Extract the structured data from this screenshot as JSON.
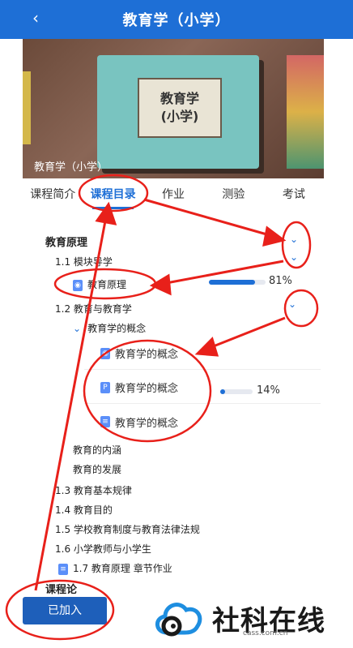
{
  "header": {
    "back_glyph": "‹",
    "title": "教育学（小学）"
  },
  "banner": {
    "book_line1": "教育学",
    "book_line2": "(小学)",
    "caption": "教育学（小学）"
  },
  "tabs": [
    {
      "label": "课程简介"
    },
    {
      "label": "课程目录"
    },
    {
      "label": "作业"
    },
    {
      "label": "测验"
    },
    {
      "label": "考试"
    }
  ],
  "catalog": {
    "section_title": "教育原理",
    "items": [
      {
        "label": "1.1 模块导学"
      },
      {
        "label": "教育原理",
        "progress": 0.81,
        "pct": "81%"
      },
      {
        "label": "1.2 教育与教育学"
      },
      {
        "label": "教育学的概念"
      },
      {
        "label": "教育学的概念"
      },
      {
        "label": "教育学的概念",
        "progress": 0.14,
        "pct": "14%"
      },
      {
        "label": "教育学的概念"
      },
      {
        "label": "教育的内涵"
      },
      {
        "label": "教育的发展"
      },
      {
        "label": "1.3 教育基本规律"
      },
      {
        "label": "1.4 教育目的"
      },
      {
        "label": "1.5 学校教育制度与教育法律法规"
      },
      {
        "label": "1.6 小学教师与小学生"
      },
      {
        "label": "1.7 教育原理 章节作业"
      }
    ]
  },
  "footer": {
    "section_title": "课程论",
    "joined_label": "已加入",
    "brand": "社科在线",
    "url": "cass.com.cn"
  },
  "colors": {
    "primary": "#1e6fd6",
    "annotation": "#e8201a"
  }
}
